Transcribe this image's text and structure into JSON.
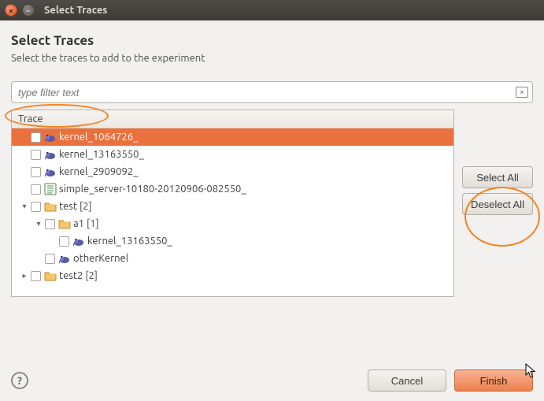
{
  "window": {
    "title": "Select Traces"
  },
  "header": {
    "title": "Select Traces",
    "subtitle": "Select the traces to add to the experiment"
  },
  "filter": {
    "placeholder": "type filter text"
  },
  "tree": {
    "column_header": "Trace",
    "rows": [
      {
        "indent": 0,
        "disclosure": "",
        "icon": "trace-icon",
        "label": "kernel_1064726_",
        "selected": true
      },
      {
        "indent": 0,
        "disclosure": "",
        "icon": "trace-icon",
        "label": "kernel_13163550_"
      },
      {
        "indent": 0,
        "disclosure": "",
        "icon": "trace-icon",
        "label": "kernel_2909092_"
      },
      {
        "indent": 0,
        "disclosure": "",
        "icon": "config-icon",
        "label": "simple_server-10180-20120906-082550_"
      },
      {
        "indent": 0,
        "disclosure": "down",
        "icon": "folder-icon",
        "label": "test [2]"
      },
      {
        "indent": 1,
        "disclosure": "down",
        "icon": "folder-icon",
        "label": "a1 [1]"
      },
      {
        "indent": 2,
        "disclosure": "",
        "icon": "trace-icon",
        "label": "kernel_13163550_"
      },
      {
        "indent": 1,
        "disclosure": "",
        "icon": "trace-icon",
        "label": "otherKernel"
      },
      {
        "indent": 0,
        "disclosure": "right",
        "icon": "folder-icon",
        "label": "test2 [2]"
      }
    ]
  },
  "buttons": {
    "select_all": "Select All",
    "deselect_all": "Deselect All",
    "cancel": "Cancel",
    "finish": "Finish"
  }
}
